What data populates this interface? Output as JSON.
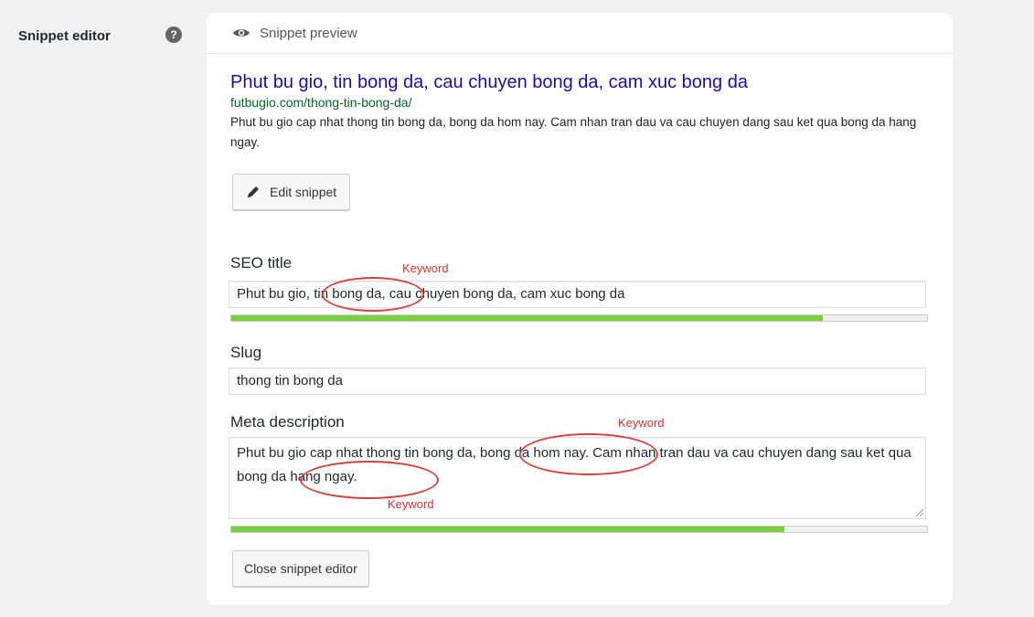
{
  "row_label": "Snippet editor",
  "help_symbol": "?",
  "preview": {
    "header": "Snippet preview",
    "title": "Phut bu gio, tin bong da, cau chuyen bong da, cam xuc bong da",
    "url": "futbugio.com/thong-tin-bong-da/",
    "description": "Phut bu gio cap nhat thong tin bong da, bong da hom nay. Cam nhan tran dau va cau chuyen dang sau ket qua bong da hang ngay."
  },
  "edit_button": "Edit snippet",
  "seo_title": {
    "label": "SEO title",
    "value": "Phut bu gio, tin bong da, cau chuyen bong da, cam xuc bong da",
    "progress": 0.85
  },
  "slug": {
    "label": "Slug",
    "value": "thong tin bong da"
  },
  "meta_description": {
    "label": "Meta description",
    "value": "Phut bu gio cap nhat thong tin bong da, bong da hom nay. Cam nhan tran dau va cau chuyen dang sau ket qua bong da hang ngay.",
    "progress": 0.795
  },
  "annotations": {
    "keyword_label": "Keyword"
  },
  "close_button": "Close snippet editor",
  "colors": {
    "progress_good": "#7ad03a",
    "annotation": "#d84040",
    "link_title": "#1a0dab",
    "link_url": "#006621"
  }
}
